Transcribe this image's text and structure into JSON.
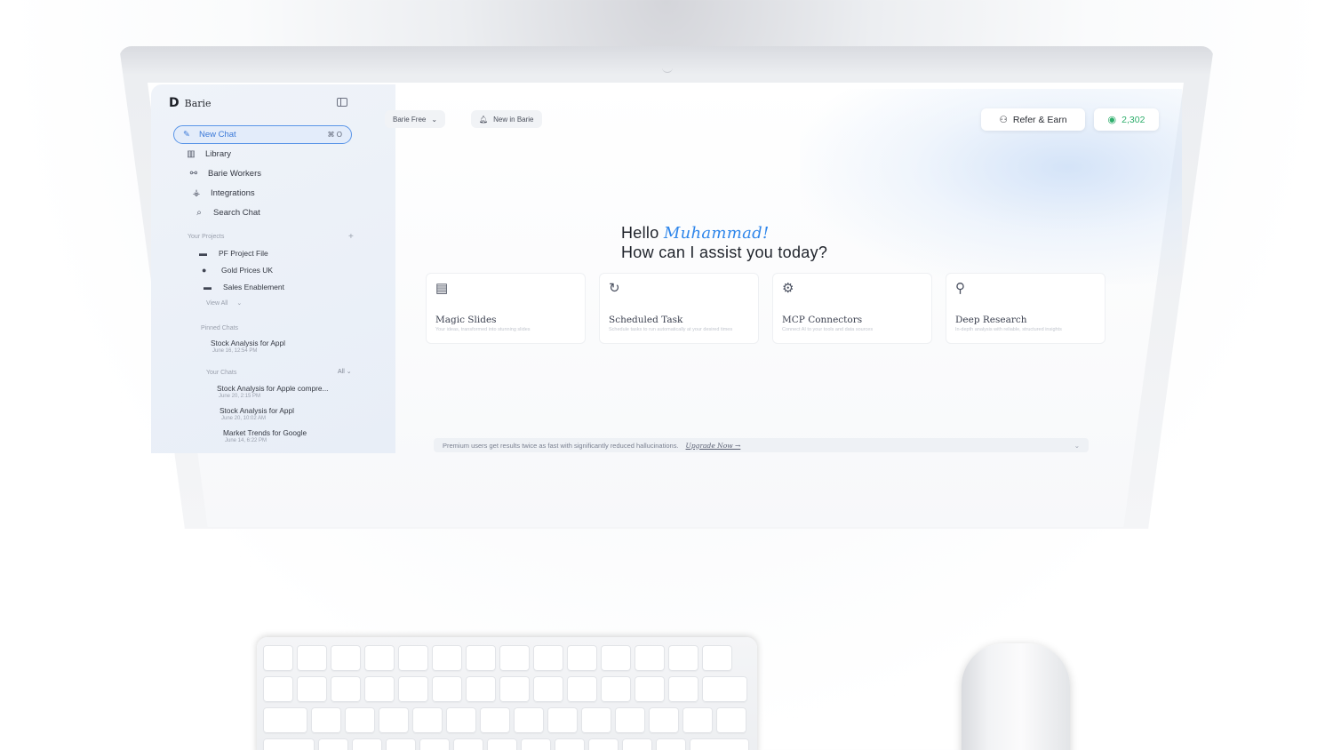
{
  "app": {
    "name": "Barie",
    "logo_glyph": "D"
  },
  "sidebar": {
    "new_chat": {
      "label": "New Chat",
      "shortcut": "⌘ O"
    },
    "nav": [
      {
        "label": "Library",
        "icon": "library-icon"
      },
      {
        "label": "Barie Workers",
        "icon": "workers-icon"
      },
      {
        "label": "Integrations",
        "icon": "integrations-icon"
      },
      {
        "label": "Search Chat",
        "icon": "search-icon"
      }
    ],
    "projects_label": "Your Projects",
    "projects": [
      {
        "label": "PF Project File",
        "icon": "folder-icon"
      },
      {
        "label": "Gold Prices UK",
        "icon": "globe-icon"
      },
      {
        "label": "Sales Enablement",
        "icon": "folder-icon"
      }
    ],
    "view_all": "View All",
    "pinned_label": "Pinned Chats",
    "pinned": [
      {
        "title": "Stock Analysis for Appl",
        "date": "June 16, 12:54 PM"
      }
    ],
    "chats_label": "Your Chats",
    "chats_filter": "All",
    "chats": [
      {
        "title": "Stock Analysis for Apple compre...",
        "date": "June 20, 2:15 PM"
      },
      {
        "title": "Stock Analysis for Appl",
        "date": "June 20, 10:02 AM"
      },
      {
        "title": "Market Trends for Google",
        "date": "June 14, 6:22 PM"
      }
    ]
  },
  "header": {
    "model_select": "Barie Free",
    "whats_new": "New in Barie",
    "refer": "Refer & Earn",
    "credits": "2,302"
  },
  "main": {
    "greeting_prefix": "Hello",
    "user_name": "Muhammad!",
    "subtitle": "How can I assist you today?",
    "cards": [
      {
        "title": "Magic Slides",
        "desc": "Your ideas, transformed into stunning slides",
        "icon": "slides-icon"
      },
      {
        "title": "Scheduled Task",
        "desc": "Schedule tasks to run automatically at your desired times",
        "icon": "schedule-icon"
      },
      {
        "title": "MCP Connectors",
        "desc": "Connect AI to your tools and data sources",
        "icon": "connectors-icon"
      },
      {
        "title": "Deep Research",
        "desc": "In-depth analysis with reliable, structured insights",
        "icon": "research-icon"
      }
    ],
    "banner": {
      "text": "Premium users get results twice as fast with significantly reduced hallucinations.",
      "link": "Upgrade Now →"
    }
  },
  "colors": {
    "accent": "#2f86ea",
    "credits": "#2fae6c",
    "sidebar_bg": "#eef2f8"
  }
}
